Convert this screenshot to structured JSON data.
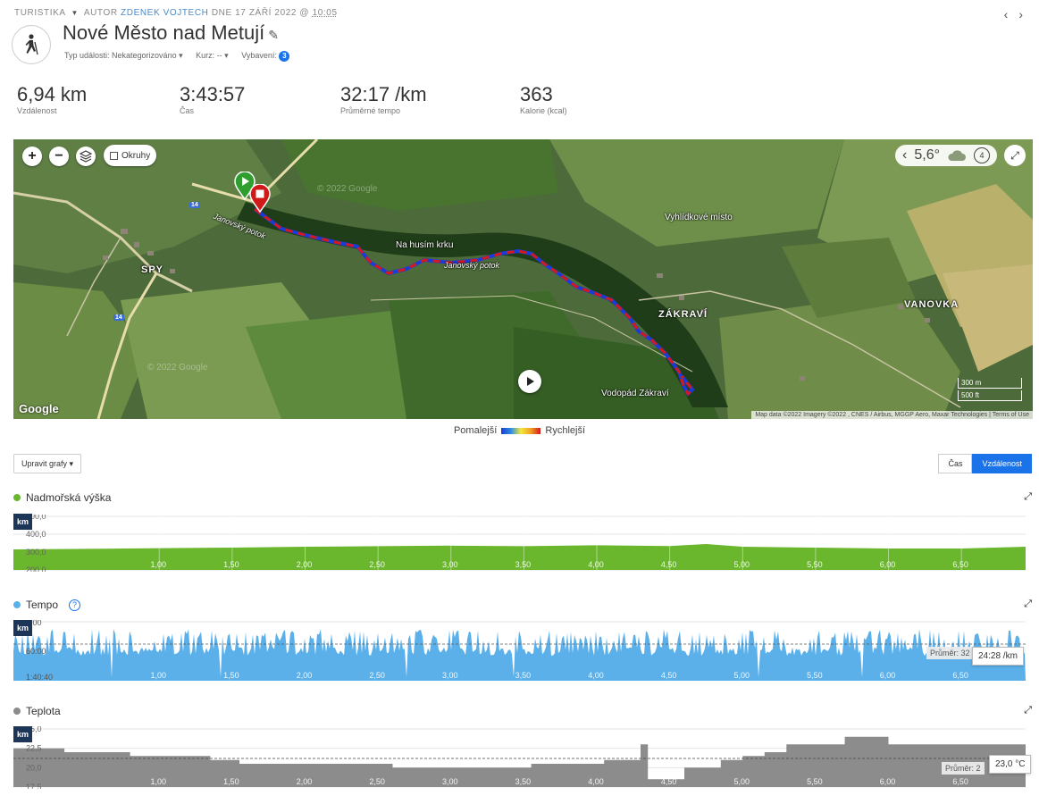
{
  "header": {
    "category": "TURISTIKA",
    "author_prefix": "AUTOR",
    "author": "ZDENEK VOJTECH",
    "date_prefix": "DNE 17 ZÁŘÍ 2022 @",
    "time": "10:05",
    "title": "Nové Město nad Metují",
    "event_type": "Typ události: Nekategorizováno",
    "course": "Kurz: --",
    "gear": "Vybavení:",
    "gear_count": "3"
  },
  "stats": [
    {
      "value": "6,94 km",
      "label": "Vzdálenost"
    },
    {
      "value": "3:43:57",
      "label": "Čas"
    },
    {
      "value": "32:17 /km",
      "label": "Průměrné tempo"
    },
    {
      "value": "363",
      "label": "Kalorie (kcal)"
    }
  ],
  "map": {
    "laps_label": "Okruhy",
    "temperature": "5,6°",
    "wind": "4",
    "labels": {
      "spy": "SPY",
      "janovsky_potok": "Janovský potok",
      "janovsky_potok2": "Janovský potok",
      "na_husim_krku": "Na husím krku",
      "vyhlidkove": "Vyhlídkové místo",
      "zakravi": "ZÁKRAVÍ",
      "vanovka": "VANOVKA",
      "vodopad": "Vodopád Zákraví",
      "road14": "14"
    },
    "watermark": "© 2022 Google",
    "google": "Google",
    "scale_m": "300 m",
    "scale_ft": "500 ft",
    "attribution": "Map data ©2022 Imagery ©2022 , CNES / Airbus, MGGP Aero, Maxar Technologies  |  Terms of Use"
  },
  "legend": {
    "slow": "Pomalejší",
    "fast": "Rychlejší"
  },
  "controls": {
    "edit_charts": "Upravit grafy ▾",
    "time": "Čas",
    "distance": "Vzdálenost"
  },
  "colors": {
    "elevation": "#6ab62c",
    "pace": "#5bb0ea",
    "temperature": "#8c8c8c",
    "accent": "#1a73e8"
  },
  "chart_data": [
    {
      "type": "area",
      "title": "Nadmořská výška",
      "x_unit": "km",
      "y_ticks": [
        "500,0",
        "400,0",
        "300,0",
        "200,0"
      ],
      "ylim": [
        200,
        500
      ],
      "x_ticks": [
        "1,00",
        "1,50",
        "2,00",
        "2,50",
        "3,00",
        "3,50",
        "4,00",
        "4,50",
        "5,00",
        "5,50",
        "6,00",
        "6,50"
      ],
      "x": [
        0.0,
        0.5,
        1.0,
        1.5,
        2.0,
        2.5,
        3.0,
        3.5,
        4.0,
        4.5,
        4.75,
        5.0,
        5.5,
        6.0,
        6.5,
        6.94
      ],
      "values": [
        315,
        318,
        322,
        325,
        330,
        333,
        336,
        333,
        338,
        334,
        345,
        330,
        325,
        320,
        320,
        330
      ]
    },
    {
      "type": "area",
      "title": "Tempo",
      "x_unit": "km",
      "y_ticks": [
        "0:00",
        "60:00",
        "1:40:40"
      ],
      "average_label": "Průměr: 32",
      "tooltip": "24:28 /km",
      "x_ticks": [
        "1,00",
        "1,50",
        "2,00",
        "2,50",
        "3,00",
        "3,50",
        "4,00",
        "4,50",
        "5,00",
        "5,50",
        "6,00",
        "6,50"
      ]
    },
    {
      "type": "area",
      "title": "Teplota",
      "x_unit": "km",
      "y_ticks": [
        "25,0",
        "22,5",
        "20,0",
        "17,5"
      ],
      "ylim": [
        17.5,
        25
      ],
      "average_label": "Průměr: 2",
      "tooltip": "23,0 °C",
      "x_ticks": [
        "1,00",
        "1,50",
        "2,00",
        "2,50",
        "3,00",
        "3,50",
        "4,00",
        "4,50",
        "5,00",
        "5,50",
        "6,00",
        "6,50"
      ],
      "x": [
        0.0,
        0.35,
        0.8,
        1.35,
        1.55,
        2.0,
        2.6,
        3.1,
        3.55,
        4.05,
        4.3,
        4.35,
        4.6,
        4.85,
        5.0,
        5.15,
        5.3,
        5.7,
        6.0,
        6.2,
        6.94
      ],
      "values": [
        22.5,
        22.0,
        21.5,
        21.0,
        20.5,
        20.5,
        20.0,
        20.0,
        20.5,
        21.0,
        23.0,
        18.5,
        20.0,
        21.0,
        21.5,
        22.0,
        23.0,
        24.0,
        23.0,
        23.0,
        22.0
      ]
    }
  ]
}
